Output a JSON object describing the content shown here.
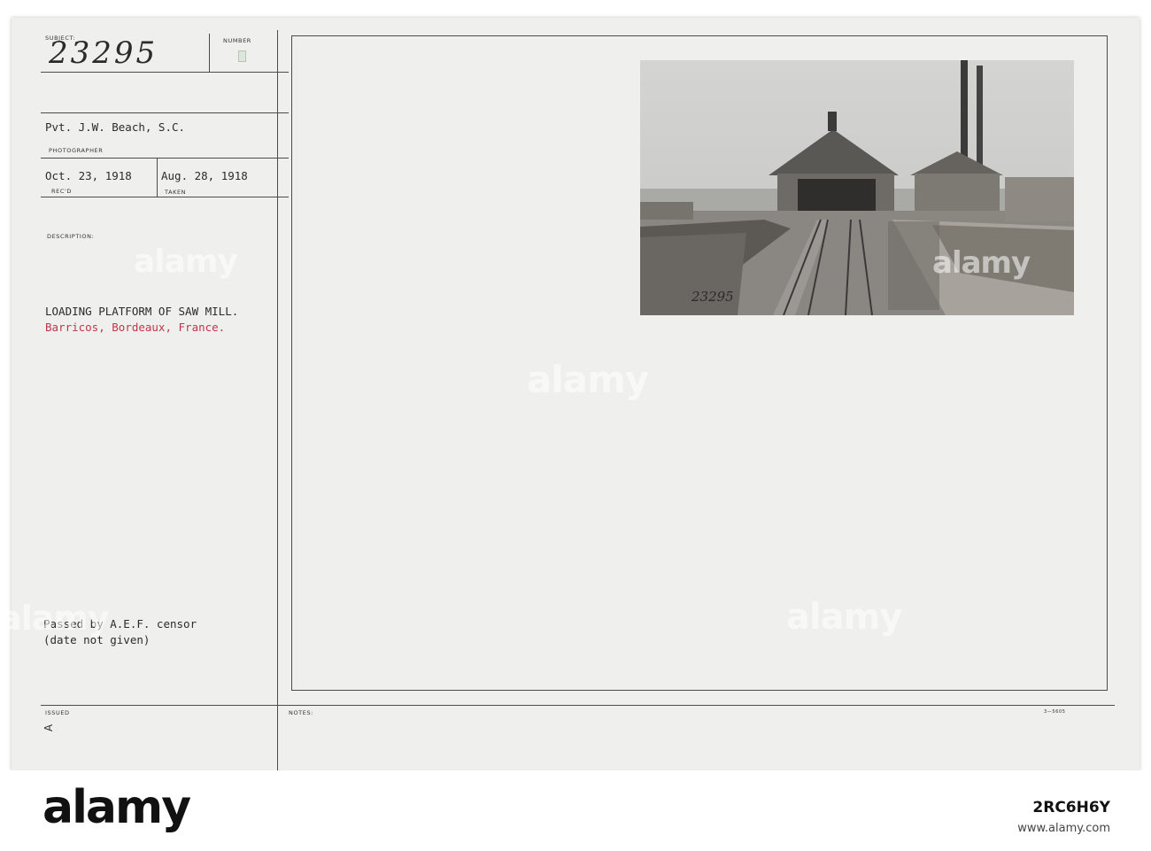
{
  "card": {
    "labels": {
      "subject": "SUBJECT:",
      "number": "NUMBER",
      "photographer": "PHOTOGRAPHER",
      "recd": "REC'D",
      "taken": "TAKEN",
      "description": "DESCRIPTION:",
      "issued": "ISSUED",
      "notes": "NOTES:"
    },
    "subject_number": "23295",
    "photographer": "Pvt. J.W. Beach, S.C.",
    "date_received": "Oct. 23, 1918",
    "date_taken": "Aug. 28, 1918",
    "description_line1": "LOADING PLATFORM OF SAW MILL.",
    "description_line2": "Barricos, Bordeaux, France.",
    "censor_line1": "Passed by A.E.F. censor",
    "censor_line2": "(date not given)",
    "issued_mark": "A",
    "form_code": "3—5605",
    "photo_caption": "23295",
    "accent_red": "#c0354a"
  },
  "watermark": {
    "text": "alamy",
    "color": "#ffffff"
  },
  "footer": {
    "logo": "alamy",
    "image_id": "2RC6H6Y",
    "url": "www.alamy.com"
  }
}
